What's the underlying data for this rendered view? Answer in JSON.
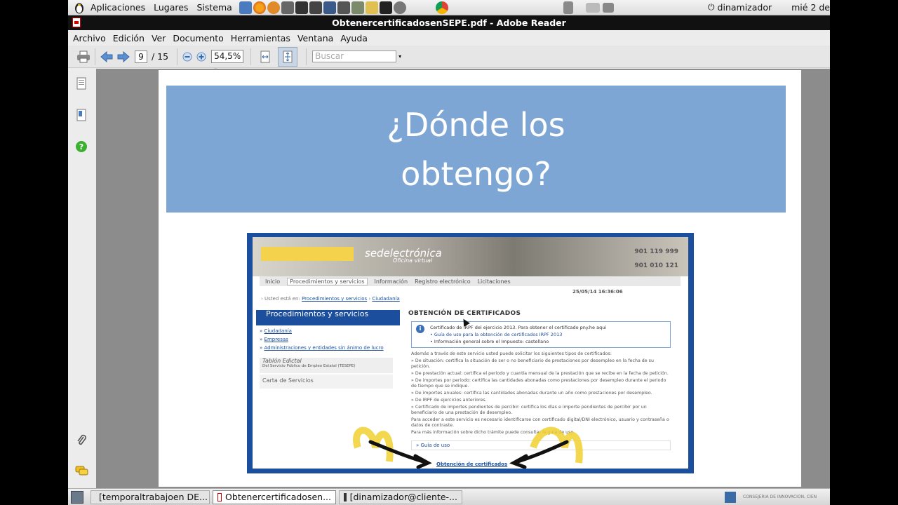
{
  "top_panel": {
    "menus": [
      "Aplicaciones",
      "Lugares",
      "Sistema"
    ],
    "user": "dinamizador",
    "clock": "mié  2 de"
  },
  "window": {
    "title": "ObtenercertificadosenSEPE.pdf - Adobe Reader"
  },
  "menubar": {
    "items": [
      "Archivo",
      "Edición",
      "Ver",
      "Documento",
      "Herramientas",
      "Ventana",
      "Ayuda"
    ]
  },
  "toolbar": {
    "page_current": "9",
    "page_total": "/ 15",
    "zoom": "54,5%",
    "search_placeholder": "Buscar"
  },
  "slide": {
    "title_line1": "¿Dónde los",
    "title_line2": "obtengo?",
    "screenshot": {
      "site_title": "sedelectrónica",
      "site_subtitle": "Oficina virtual",
      "phone1": "901 119 999",
      "phone2": "901 010 121",
      "nav": [
        "Inicio",
        "Procedimientos y servicios",
        "Información",
        "Registro electrónico",
        "Licitaciones"
      ],
      "crumb_prefix": "Usted está en:",
      "crumb_link1": "Procedimientos y servicios",
      "crumb_link2": "Ciudadanía",
      "date": "25/05/14   16:36:06",
      "sidebar_heading": "Procedimientos y servicios",
      "sidebar_links": [
        "Ciudadanía",
        "Empresas",
        "Administraciones y entidades sin ánimo de lucro"
      ],
      "tablon": "Tablón Edictal",
      "tablon_sub": "Del Servicio Público de Empleo Estatal (TESEPE)",
      "carta": "Carta de Servicios",
      "content_title": "OBTENCIÓN DE CERTIFICADOS",
      "info_lines": [
        "Certificado de IRPF del ejercicio 2013. Para obtener el certificado pny.he aqui",
        "• Guía de uso para la obtención de certificados IRPF 2013",
        "• Información general sobre el Impuesto: castellano"
      ],
      "body_lines": [
        "Además a través de este servicio usted puede solicitar los siguientes tipos de certificados:",
        "» De situación: certifica la situación de ser o no beneficiario de prestaciones por desempleo en la fecha de su petición.",
        "» De prestación actual: certifica el periodo y cuantía mensual de la prestación que se recibe en la fecha de petición.",
        "» De importes por periodo: certifica las cantidades abonadas como prestaciones por desempleo durante el periodo de tiempo que se indique.",
        "» De importes anuales: certifica las cantidades abonadas durante un año como prestaciones por desempleo.",
        "» De IRPF de ejercicios anteriores.",
        "» Certificado de importes pendientes de percibir: certifica los días e importe pendientes de percibir por un beneficiario de una prestación de desempleo.",
        "Para acceder a este servicio es necesario identificarse con certificado digital/DNI electrónico, usuario y contraseña o datos de contraste.",
        "Para más información sobre dicho trámite puede consultar la guía de uso."
      ],
      "guia": "» Guía de uso",
      "obtencion_link": "Obtención de certificados"
    }
  },
  "taskbar": {
    "tasks": [
      "[temporaltrabajoen DE...",
      "Obtenercertificadosen...",
      "[dinamizador@cliente-..."
    ],
    "footer_text": "CONSEJERÍA DE INNOVACIÓN, CIEN"
  }
}
